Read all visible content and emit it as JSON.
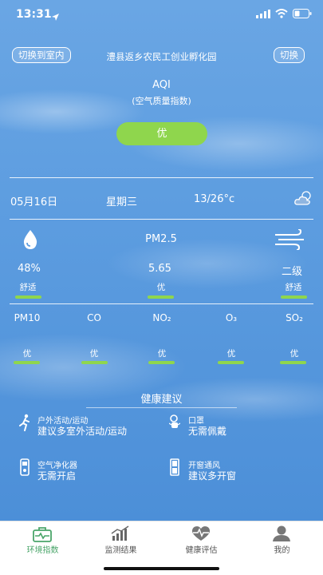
{
  "status_bar": {
    "time": "13:31"
  },
  "header": {
    "left_button": "切换到室内",
    "title": "澧县返乡农民工创业孵化园",
    "right_button": "切换"
  },
  "aqi": {
    "title": "AQI",
    "subtitle": "(空气质量指数)",
    "level": "优"
  },
  "date_row": {
    "date": "05月16日",
    "weekday": "星期三",
    "temp": "13/26°c",
    "weather_icon": "cloudy-icon"
  },
  "main_metrics": {
    "pm25_label": "PM2.5",
    "humidity": {
      "value": "48%",
      "status": "舒适",
      "icon": "humidity-drop-icon"
    },
    "pm25": {
      "value": "5.65",
      "status": "优"
    },
    "wind": {
      "value": "二级",
      "status": "舒适",
      "icon": "wind-icon"
    }
  },
  "pollutants": [
    {
      "name": "PM10",
      "status": "优"
    },
    {
      "name": "CO",
      "status": "优"
    },
    {
      "name": "NO₂",
      "status": "优"
    },
    {
      "name": "O₃",
      "status": "优"
    },
    {
      "name": "SO₂",
      "status": "优"
    }
  ],
  "advice": {
    "title": "健康建议",
    "items": [
      {
        "label": "户外活动/运动",
        "value": "建议多室外活动/运动",
        "icon": "running-person-icon"
      },
      {
        "label": "口罩",
        "value": "无需佩戴",
        "icon": "mask-icon"
      },
      {
        "label": "空气净化器",
        "value": "无需开启",
        "icon": "air-purifier-icon"
      },
      {
        "label": "开窗通风",
        "value": "建议多开窗",
        "icon": "window-icon"
      }
    ]
  },
  "tabs": [
    {
      "label": "环境指数",
      "icon": "briefcase-medical-icon",
      "active": true
    },
    {
      "label": "监测结果",
      "icon": "bar-chart-icon",
      "active": false
    },
    {
      "label": "健康评估",
      "icon": "heart-pulse-icon",
      "active": false
    },
    {
      "label": "我的",
      "icon": "person-icon",
      "active": false
    }
  ],
  "colors": {
    "accent_green": "#8fd64d",
    "tab_active": "#4aa56a",
    "sky": "#5d9de0"
  }
}
